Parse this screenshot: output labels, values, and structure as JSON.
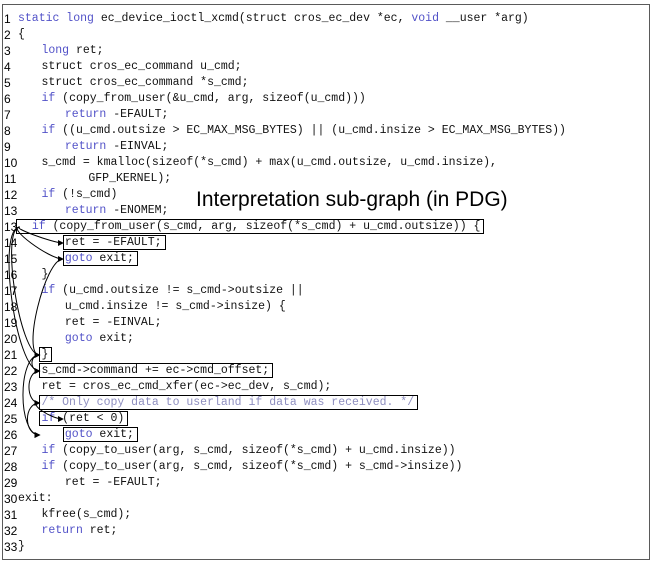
{
  "title": "Interpretation sub-graph (in PDG)",
  "colors": {
    "keyword": "#5252c8",
    "comment": "#8f8fc0",
    "text": "#111111",
    "edge": "#000000"
  },
  "lines": [
    {
      "num": "1",
      "indent": 0,
      "segments": [
        {
          "t": "static long",
          "k": "kw"
        },
        {
          "t": " ec_device_ioctl_xcmd(struct cros_ec_dev *ec, "
        },
        {
          "t": "void",
          "k": "kw"
        },
        {
          "t": " __user *arg)"
        }
      ]
    },
    {
      "num": "2",
      "indent": 0,
      "segments": [
        {
          "t": "{"
        }
      ]
    },
    {
      "num": "3",
      "indent": 1,
      "segments": [
        {
          "t": "long",
          "k": "kw"
        },
        {
          "t": " ret;"
        }
      ]
    },
    {
      "num": "4",
      "indent": 1,
      "segments": [
        {
          "t": "struct cros_ec_command u_cmd;"
        }
      ]
    },
    {
      "num": "5",
      "indent": 1,
      "segments": [
        {
          "t": "struct cros_ec_command *s_cmd;"
        }
      ]
    },
    {
      "num": "6",
      "indent": 1,
      "segments": [
        {
          "t": "if",
          "k": "kw"
        },
        {
          "t": " (copy_from_user(&u_cmd, arg, sizeof(u_cmd)))"
        }
      ]
    },
    {
      "num": "7",
      "indent": 2,
      "segments": [
        {
          "t": "return",
          "k": "kw"
        },
        {
          "t": " -EFAULT;"
        }
      ]
    },
    {
      "num": "8",
      "indent": 1,
      "segments": [
        {
          "t": "if",
          "k": "kw"
        },
        {
          "t": " ((u_cmd.outsize > EC_MAX_MSG_BYTES) || (u_cmd.insize > EC_MAX_MSG_BYTES))"
        }
      ]
    },
    {
      "num": "9",
      "indent": 2,
      "segments": [
        {
          "t": "return",
          "k": "kw"
        },
        {
          "t": " -EINVAL;"
        }
      ]
    },
    {
      "num": "10",
      "indent": 1,
      "segments": [
        {
          "t": "s_cmd = kmalloc(sizeof(*s_cmd) + max(u_cmd.outsize, u_cmd.insize),"
        }
      ]
    },
    {
      "num": "11",
      "indent": 3,
      "segments": [
        {
          "t": "GFP_KERNEL);"
        }
      ]
    },
    {
      "num": "12",
      "indent": 1,
      "segments": [
        {
          "t": "if",
          "k": "kw"
        },
        {
          "t": " (!s_cmd)"
        }
      ]
    },
    {
      "num": "13",
      "indent": 2,
      "segments": [
        {
          "t": "return",
          "k": "kw"
        },
        {
          "t": " -ENOMEM;"
        }
      ]
    },
    {
      "num": "13",
      "indent": 0,
      "segments": [
        {
          "t": "  "
        },
        {
          "t": "if",
          "k": "kw"
        },
        {
          "t": " (copy_from_user(s_cmd, arg, sizeof(*s_cmd) + u_cmd.outsize)) {"
        }
      ]
    },
    {
      "num": "14",
      "indent": 2,
      "segments": [
        {
          "t": "ret = -EFAULT;"
        }
      ]
    },
    {
      "num": "15",
      "indent": 2,
      "segments": [
        {
          "t": "goto",
          "k": "kw"
        },
        {
          "t": " exit;"
        }
      ]
    },
    {
      "num": "16",
      "indent": 1,
      "segments": [
        {
          "t": "}"
        }
      ]
    },
    {
      "num": "17",
      "indent": 1,
      "segments": [
        {
          "t": "if",
          "k": "kw"
        },
        {
          "t": " (u_cmd.outsize != s_cmd->outsize ||"
        }
      ]
    },
    {
      "num": "18",
      "indent": 2,
      "segments": [
        {
          "t": "u_cmd.insize != s_cmd->insize) {"
        }
      ]
    },
    {
      "num": "19",
      "indent": 2,
      "segments": [
        {
          "t": "ret = -EINVAL;"
        }
      ]
    },
    {
      "num": "20",
      "indent": 2,
      "segments": [
        {
          "t": "goto",
          "k": "kw"
        },
        {
          "t": " exit;"
        }
      ]
    },
    {
      "num": "21",
      "indent": 1,
      "segments": [
        {
          "t": "}"
        }
      ]
    },
    {
      "num": "22",
      "indent": 1,
      "segments": [
        {
          "t": "s_cmd->command += ec->cmd_offset;"
        }
      ]
    },
    {
      "num": "23",
      "indent": 1,
      "segments": [
        {
          "t": "ret = cros_ec_cmd_xfer(ec->ec_dev, s_cmd);"
        }
      ]
    },
    {
      "num": "24",
      "indent": 1,
      "segments": [
        {
          "t": "/* Only copy data to userland if data was received. */",
          "k": "cm"
        }
      ]
    },
    {
      "num": "25",
      "indent": 1,
      "segments": [
        {
          "t": "if",
          "k": "kw"
        },
        {
          "t": " (ret < 0)"
        }
      ]
    },
    {
      "num": "26",
      "indent": 2,
      "segments": [
        {
          "t": "goto",
          "k": "kw"
        },
        {
          "t": " exit;"
        }
      ]
    },
    {
      "num": "27",
      "indent": 1,
      "segments": [
        {
          "t": "if",
          "k": "kw"
        },
        {
          "t": " (copy_to_user(arg, s_cmd, sizeof(*s_cmd) + u_cmd.insize))"
        }
      ]
    },
    {
      "num": "28",
      "indent": 1,
      "segments": [
        {
          "t": "if",
          "k": "kw"
        },
        {
          "t": " (copy_to_user(arg, s_cmd, sizeof(*s_cmd) + s_cmd->insize))"
        }
      ]
    },
    {
      "num": "29",
      "indent": 2,
      "segments": [
        {
          "t": "ret = -EFAULT;"
        }
      ]
    },
    {
      "num": "30",
      "indent": 0,
      "segments": [
        {
          "t": "exit:"
        }
      ]
    },
    {
      "num": "31",
      "indent": 1,
      "segments": [
        {
          "t": "kfree(s_cmd);"
        }
      ]
    },
    {
      "num": "32",
      "indent": 1,
      "segments": [
        {
          "t": "return",
          "k": "kw"
        },
        {
          "t": " ret;"
        }
      ]
    },
    {
      "num": "33",
      "indent": 0,
      "segments": [
        {
          "t": "}"
        }
      ]
    }
  ],
  "highlighted_lines": [
    13,
    14,
    15,
    21,
    22,
    24,
    25,
    26
  ]
}
